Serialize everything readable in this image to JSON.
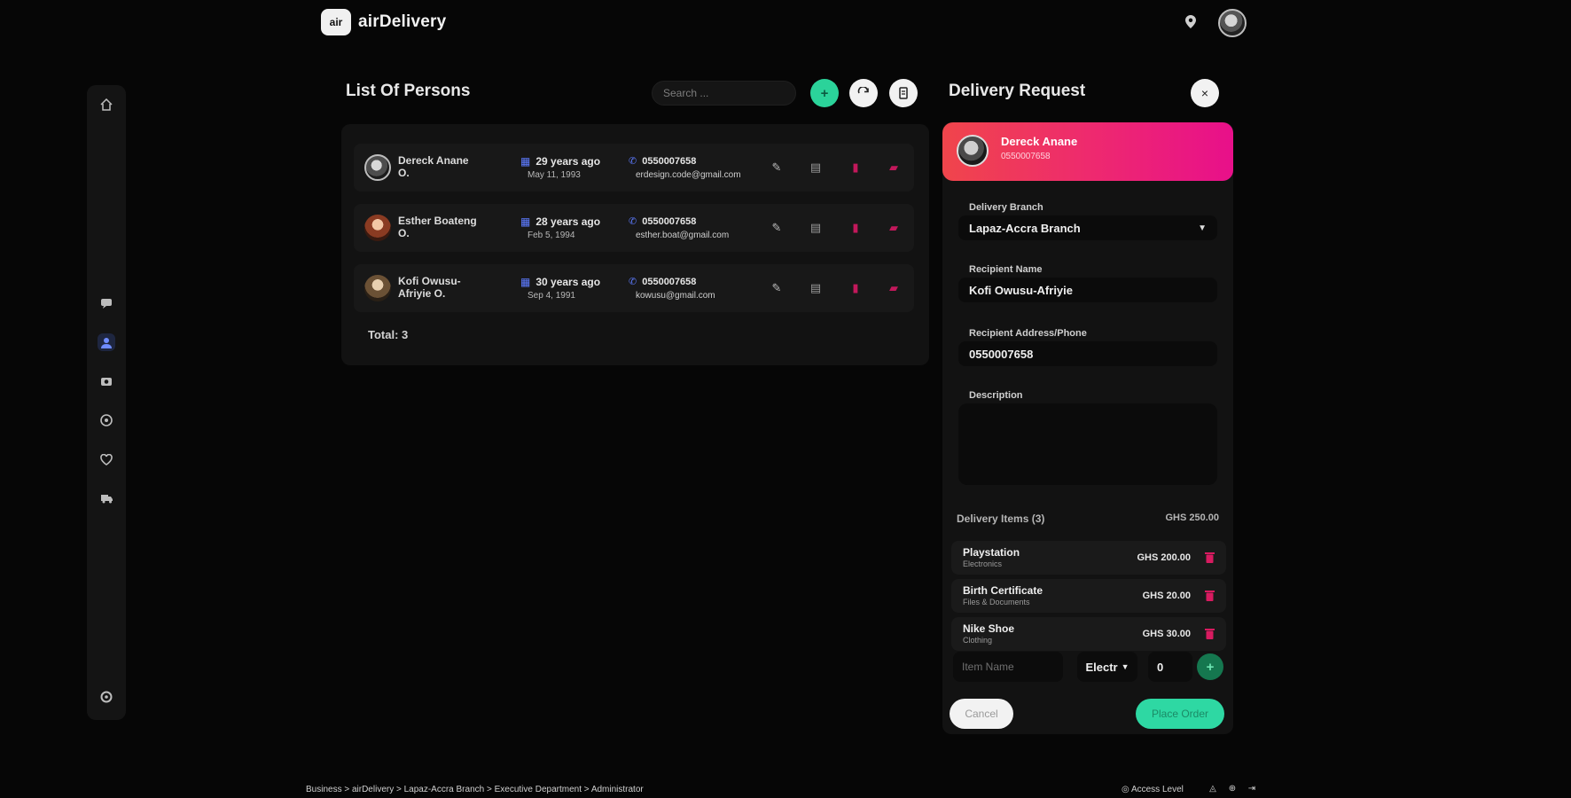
{
  "app": {
    "name": "airDelivery",
    "logo_mark": "air"
  },
  "header": {
    "location_icon": "map-pin-icon"
  },
  "rail": {
    "icons": [
      "home-icon",
      "chat-icon",
      "person-icon",
      "camera-icon",
      "location-icon",
      "heart-icon",
      "truck-icon",
      "settings-icon"
    ],
    "active": "person-icon"
  },
  "list": {
    "title": "List Of Persons",
    "search_placeholder": "Search ...",
    "add_label": "+",
    "total": "Total: 3",
    "persons": [
      {
        "name": "Dereck Anane O.",
        "age": "29 years ago",
        "dob": "May 11, 1993",
        "phone": "0550007658",
        "email": "erdesign.code@gmail.com"
      },
      {
        "name": "Esther Boateng O.",
        "age": "28 years ago",
        "dob": "Feb 5, 1994",
        "phone": "0550007658",
        "email": "esther.boat@gmail.com"
      },
      {
        "name": "Kofi Owusu-Afriyie O.",
        "age": "30 years ago",
        "dob": "Sep 4, 1991",
        "phone": "0550007658",
        "email": "kowusu@gmail.com"
      }
    ]
  },
  "request": {
    "title": "Delivery Request",
    "recipient_card": {
      "name": "Dereck Anane",
      "phone": "0550007658"
    },
    "branch_label": "Delivery Branch",
    "branch_value": "Lapaz-Accra Branch",
    "recipient_name_label": "Recipient Name",
    "recipient_name_value": "Kofi Owusu-Afriyie",
    "recipient_contact_label": "Recipient Address/Phone",
    "recipient_contact_value": "0550007658",
    "description_label": "Description",
    "items_label": "Delivery Items (3)",
    "items_total": "GHS 250.00",
    "items": [
      {
        "name": "Playstation",
        "category": "Electronics",
        "price": "GHS 200.00"
      },
      {
        "name": "Birth Certificate",
        "category": "Files & Documents",
        "price": "GHS 20.00"
      },
      {
        "name": "Nike Shoe",
        "category": "Clothing",
        "price": "GHS 30.00"
      }
    ],
    "new_item_placeholder": "Item Name",
    "new_item_category": "Electr",
    "new_item_qty": "0",
    "cancel_label": "Cancel",
    "place_order_label": "Place Order"
  },
  "footer": {
    "breadcrumb": "Business > airDelivery > Lapaz-Accra Branch > Executive Department > Administrator",
    "access": "Access Level"
  }
}
